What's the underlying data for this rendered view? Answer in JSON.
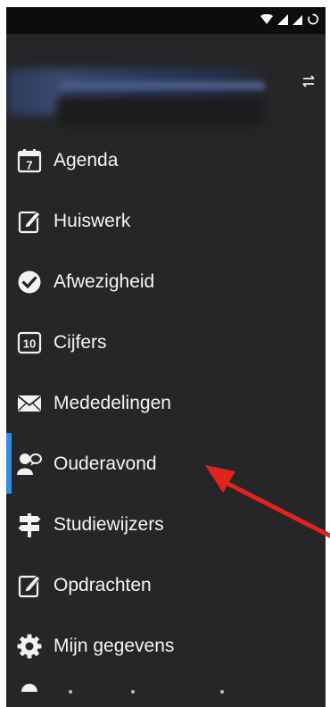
{
  "status_bar": {
    "icons": [
      "wifi-icon",
      "signal-icon",
      "signal-icon",
      "sync-icon"
    ]
  },
  "header": {
    "switch_icon": "swap-arrows-icon"
  },
  "menu": {
    "items": [
      {
        "id": "agenda",
        "label": "Agenda",
        "icon": "calendar-icon",
        "calendar_day": "7",
        "active": false
      },
      {
        "id": "huiswerk",
        "label": "Huiswerk",
        "icon": "edit-note-icon",
        "active": false
      },
      {
        "id": "afwezigheid",
        "label": "Afwezigheid",
        "icon": "check-circle-icon",
        "active": false
      },
      {
        "id": "cijfers",
        "label": "Cijfers",
        "icon": "grade-box-icon",
        "grade_value": "10",
        "active": false
      },
      {
        "id": "mededelingen",
        "label": "Mededelingen",
        "icon": "envelope-icon",
        "active": false
      },
      {
        "id": "ouderavond",
        "label": "Ouderavond",
        "icon": "person-chat-icon",
        "active": true
      },
      {
        "id": "studiewijzers",
        "label": "Studiewijzers",
        "icon": "signpost-icon",
        "active": false
      },
      {
        "id": "opdrachten",
        "label": "Opdrachten",
        "icon": "edit-note-icon",
        "active": false
      },
      {
        "id": "mijn-gegevens",
        "label": "Mijn gegevens",
        "icon": "gear-icon",
        "active": false
      }
    ]
  },
  "colors": {
    "drawer_bg": "#262628",
    "status_bar_bg": "#0d0d0d",
    "text": "#f5f5f5",
    "active_indicator": "#2f8fe6",
    "annotation_arrow": "#e0241c"
  },
  "annotation": {
    "type": "arrow",
    "points_to": "ouderavond"
  }
}
